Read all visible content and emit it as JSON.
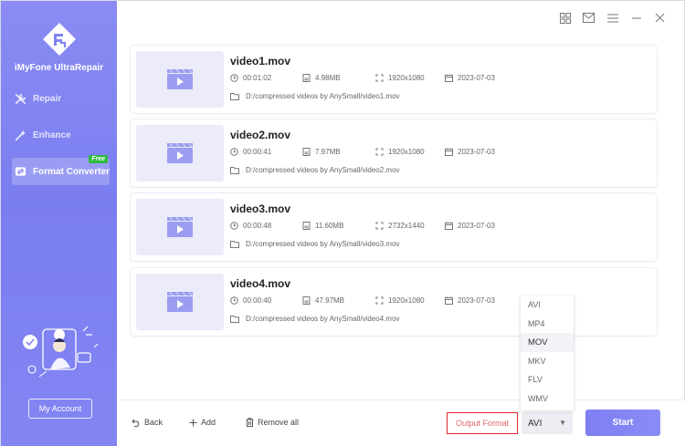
{
  "app": {
    "name": "iMyFone UltraRepair"
  },
  "sidebar": {
    "items": [
      {
        "label": "Repair",
        "icon": "wrench-icon"
      },
      {
        "label": "Enhance",
        "icon": "magic-wand-icon"
      },
      {
        "label": "Format Converter",
        "icon": "convert-icon",
        "badge": "Free",
        "active": true
      }
    ],
    "account_label": "My Account"
  },
  "titlebar": {
    "icons": [
      "grid-icon",
      "mail-icon",
      "menu-icon",
      "minimize-icon",
      "close-icon"
    ]
  },
  "videos": [
    {
      "name": "video1.mov",
      "duration": "00:01:02",
      "size": "4.98MB",
      "resolution": "1920x1080",
      "date": "2023-07-03",
      "path": "D:/compressed videos by AnySmall/video1.mov"
    },
    {
      "name": "video2.mov",
      "duration": "00:00:41",
      "size": "7.97MB",
      "resolution": "1920x1080",
      "date": "2023-07-03",
      "path": "D:/compressed videos by AnySmall/video2.mov"
    },
    {
      "name": "video3.mov",
      "duration": "00:00:48",
      "size": "11.60MB",
      "resolution": "2732x1440",
      "date": "2023-07-03",
      "path": "D:/compressed videos by AnySmall/video3.mov"
    },
    {
      "name": "video4.mov",
      "duration": "00:00:40",
      "size": "47.97MB",
      "resolution": "1920x1080",
      "date": "2023-07-03",
      "path": "D:/compressed videos by AnySmall/video4.mov"
    }
  ],
  "bottom": {
    "back_label": "Back",
    "add_label": "Add",
    "remove_label": "Remove all",
    "output_format_label": "Output Format",
    "selected_format": "AVI",
    "format_options": [
      "AVI",
      "MP4",
      "MOV",
      "MKV",
      "FLV",
      "WMV"
    ],
    "highlighted_option": "MOV",
    "start_label": "Start"
  },
  "colors": {
    "accent": "#7e7ff2",
    "sidebar": "#8385f2",
    "highlight_border": "#e0282d",
    "free_badge": "#2dbb3f"
  }
}
